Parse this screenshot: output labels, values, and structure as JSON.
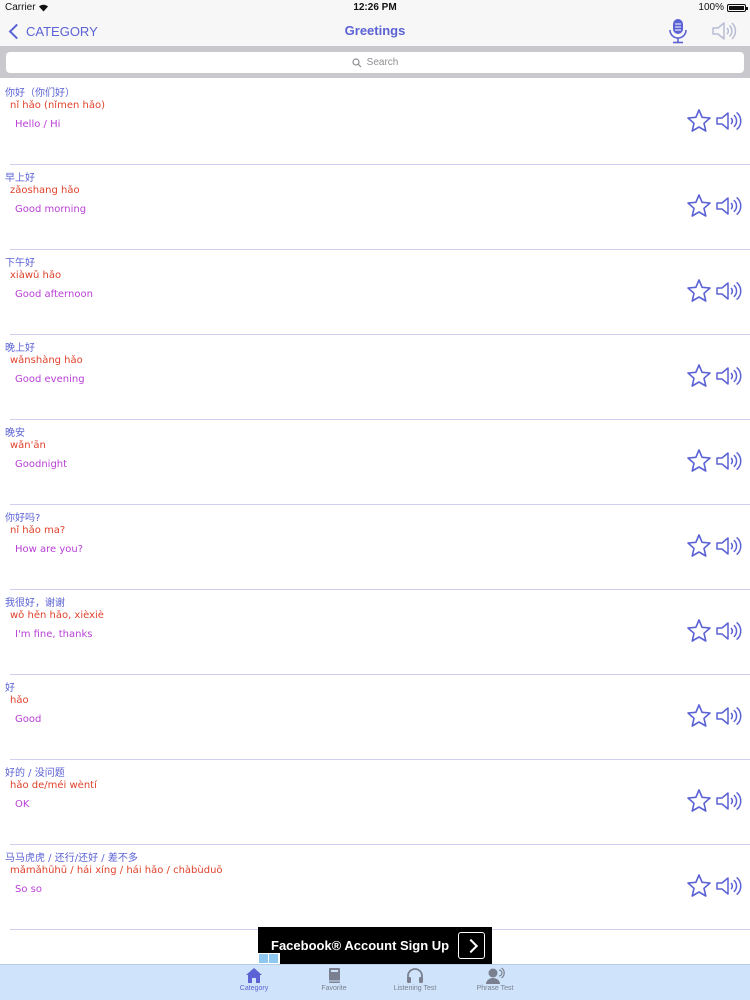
{
  "status_bar": {
    "carrier": "Carrier",
    "time": "12:26 PM",
    "battery": "100%"
  },
  "nav": {
    "back_label": "CATEGORY",
    "title": "Greetings"
  },
  "search": {
    "placeholder": "Search"
  },
  "phrases": [
    {
      "hanzi": "你好（你们好）",
      "pinyin": "nǐ hǎo (nǐmen hǎo)",
      "english": "Hello / Hi"
    },
    {
      "hanzi": "早上好",
      "pinyin": "zǎoshang hǎo",
      "english": "Good morning"
    },
    {
      "hanzi": "下午好",
      "pinyin": "xiàwǔ hǎo",
      "english": "Good afternoon"
    },
    {
      "hanzi": "晚上好",
      "pinyin": "wǎnshàng hǎo",
      "english": "Good evening"
    },
    {
      "hanzi": "晚安",
      "pinyin": "wǎn'ān",
      "english": "Goodnight"
    },
    {
      "hanzi": "你好吗?",
      "pinyin": "nǐ hǎo ma?",
      "english": "How are you?"
    },
    {
      "hanzi": "我很好，谢谢",
      "pinyin": "wǒ hěn hǎo, xièxiè",
      "english": "I'm fine, thanks"
    },
    {
      "hanzi": "好",
      "pinyin": "hǎo",
      "english": "Good"
    },
    {
      "hanzi": "好的 / 没问题",
      "pinyin": "hǎo de/méi wèntí",
      "english": "OK"
    },
    {
      "hanzi": "马马虎虎 / 还行/还好 / 差不多",
      "pinyin": "mǎmǎhūhū / hái xíng / hái hǎo / chàbùduō",
      "english": "So so"
    }
  ],
  "ad": {
    "text": "Facebook® Account Sign Up"
  },
  "tabs": [
    {
      "label": "Category",
      "icon": "home-icon"
    },
    {
      "label": "Favorite",
      "icon": "book-icon"
    },
    {
      "label": "Listening Test",
      "icon": "headphones-icon"
    },
    {
      "label": "Phrase Test",
      "icon": "user-speaking-icon"
    }
  ],
  "colors": {
    "accent": "#5b62d4",
    "pinyin": "#e0422c",
    "english": "#b93fd6",
    "tab_bar_bg": "#cfe4fa"
  }
}
